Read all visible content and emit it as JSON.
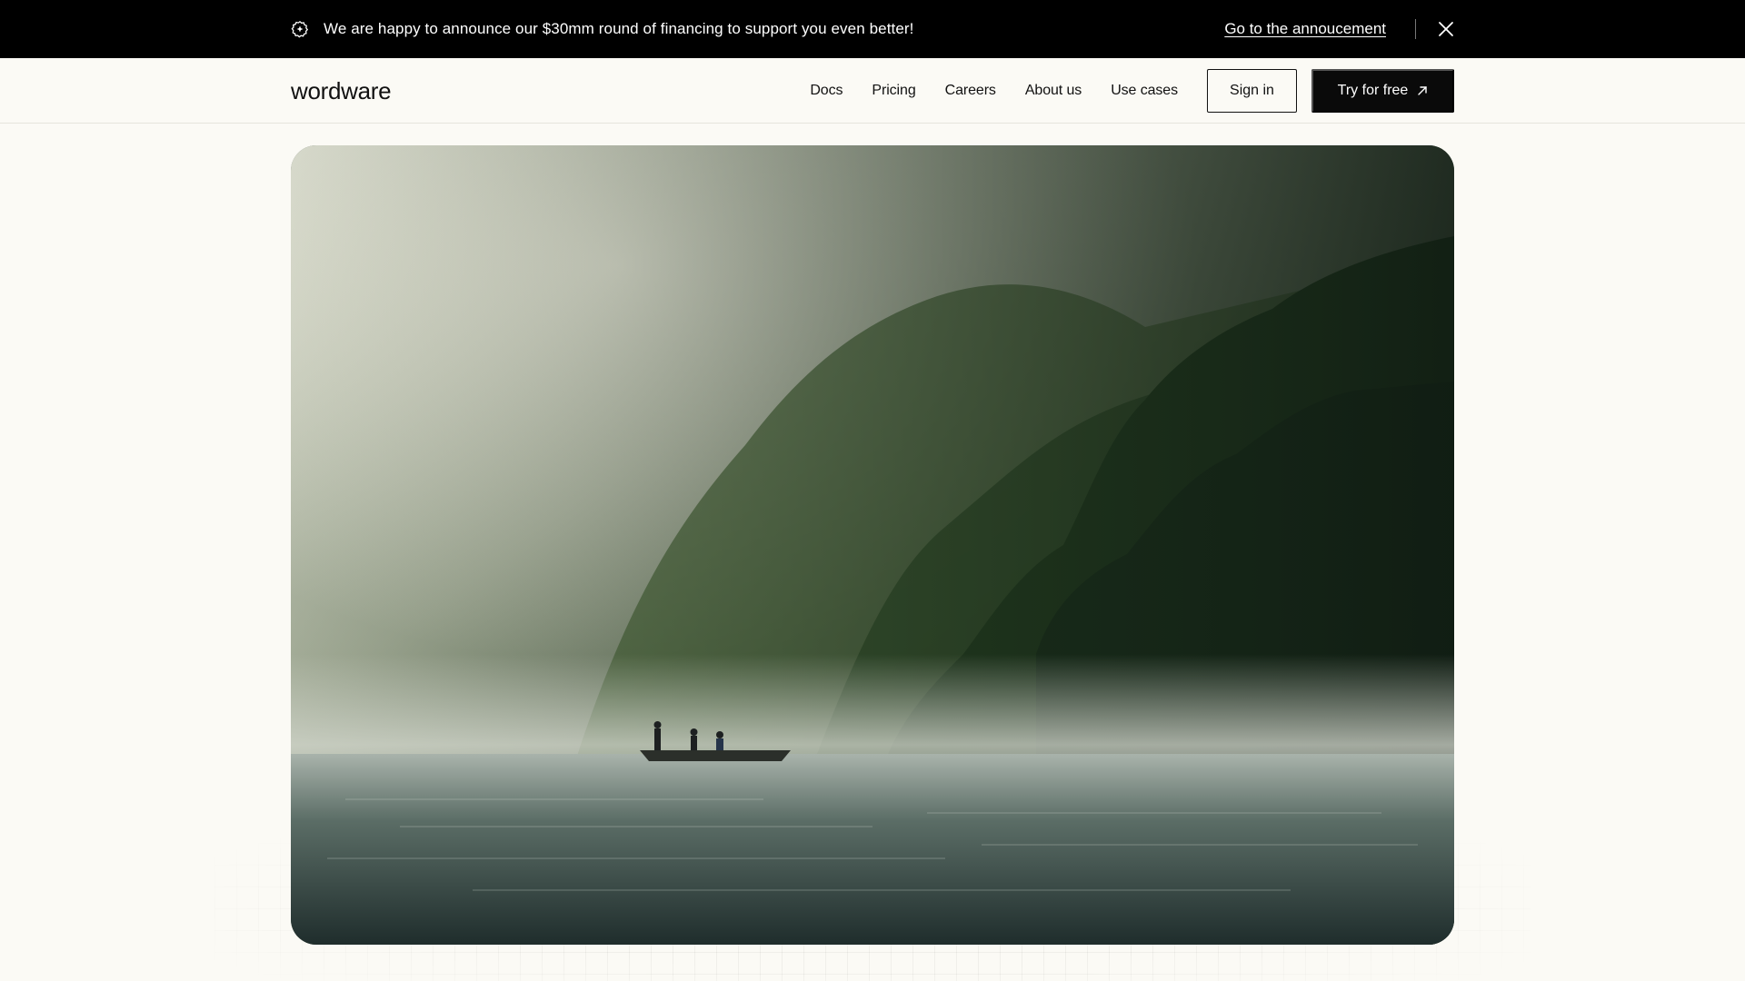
{
  "announcement": {
    "icon": "sparkle-badge-icon",
    "text": "We are happy to announce our $30mm round of financing to support you even better!",
    "link_label": "Go to the annoucement",
    "close_icon": "close-icon"
  },
  "header": {
    "logo": "wordware",
    "nav": [
      {
        "label": "Docs"
      },
      {
        "label": "Pricing"
      },
      {
        "label": "Careers"
      },
      {
        "label": "About us"
      },
      {
        "label": "Use cases"
      }
    ],
    "signin_label": "Sign in",
    "try_label": "Try for free",
    "try_icon": "arrow-up-right-icon"
  },
  "hero": {
    "image_subject": "misty-forest-lake-with-boat-illustration"
  },
  "colors": {
    "announcement_bg": "#000000",
    "page_bg": "#fbfaf5",
    "primary_button_bg": "#0a0a0a",
    "text": "#111111"
  }
}
